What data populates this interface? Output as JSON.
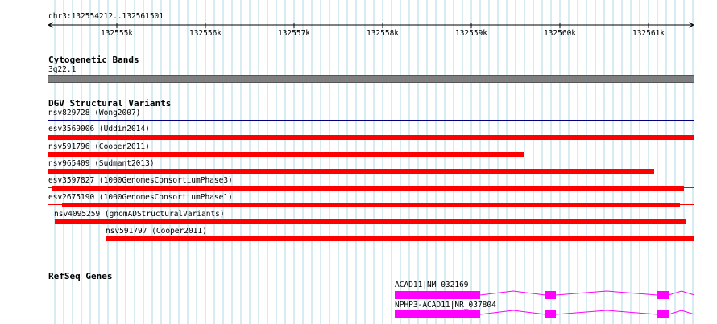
{
  "ruler": {
    "location": "chr3:132554212..132561501",
    "ticks": [
      "132555k",
      "132556k",
      "132557k",
      "132558k",
      "132559k",
      "132560k",
      "132561k"
    ]
  },
  "cytoband": {
    "title": "Cytogenetic Bands",
    "band_label": "3q22.1"
  },
  "dgv": {
    "title": "DGV Structural Variants",
    "variants": [
      {
        "label": "nsv829728 (Wong2007)"
      },
      {
        "label": "esv3569006 (Uddin2014)"
      },
      {
        "label": "nsv591796 (Cooper2011)"
      },
      {
        "label": "nsv965409 (Sudmant2013)"
      },
      {
        "label": "esv3597827 (1000GenomesConsortiumPhase3)"
      },
      {
        "label": "esv2675190 (1000GenomesConsortiumPhase1)"
      },
      {
        "label": "nsv4095259 (gnomADStructuralVariants)"
      },
      {
        "label": "nsv591797 (Cooper2011)"
      }
    ]
  },
  "refseq": {
    "title": "RefSeq Genes",
    "genes": [
      {
        "label": "ACAD11|NM_032169"
      },
      {
        "label": "NPHP3-ACAD11|NR_037804"
      }
    ]
  },
  "colors": {
    "variant": "#ff0000",
    "gene": "#ff00ff",
    "grid": "#add8e6",
    "band": "#7f7f7f"
  }
}
